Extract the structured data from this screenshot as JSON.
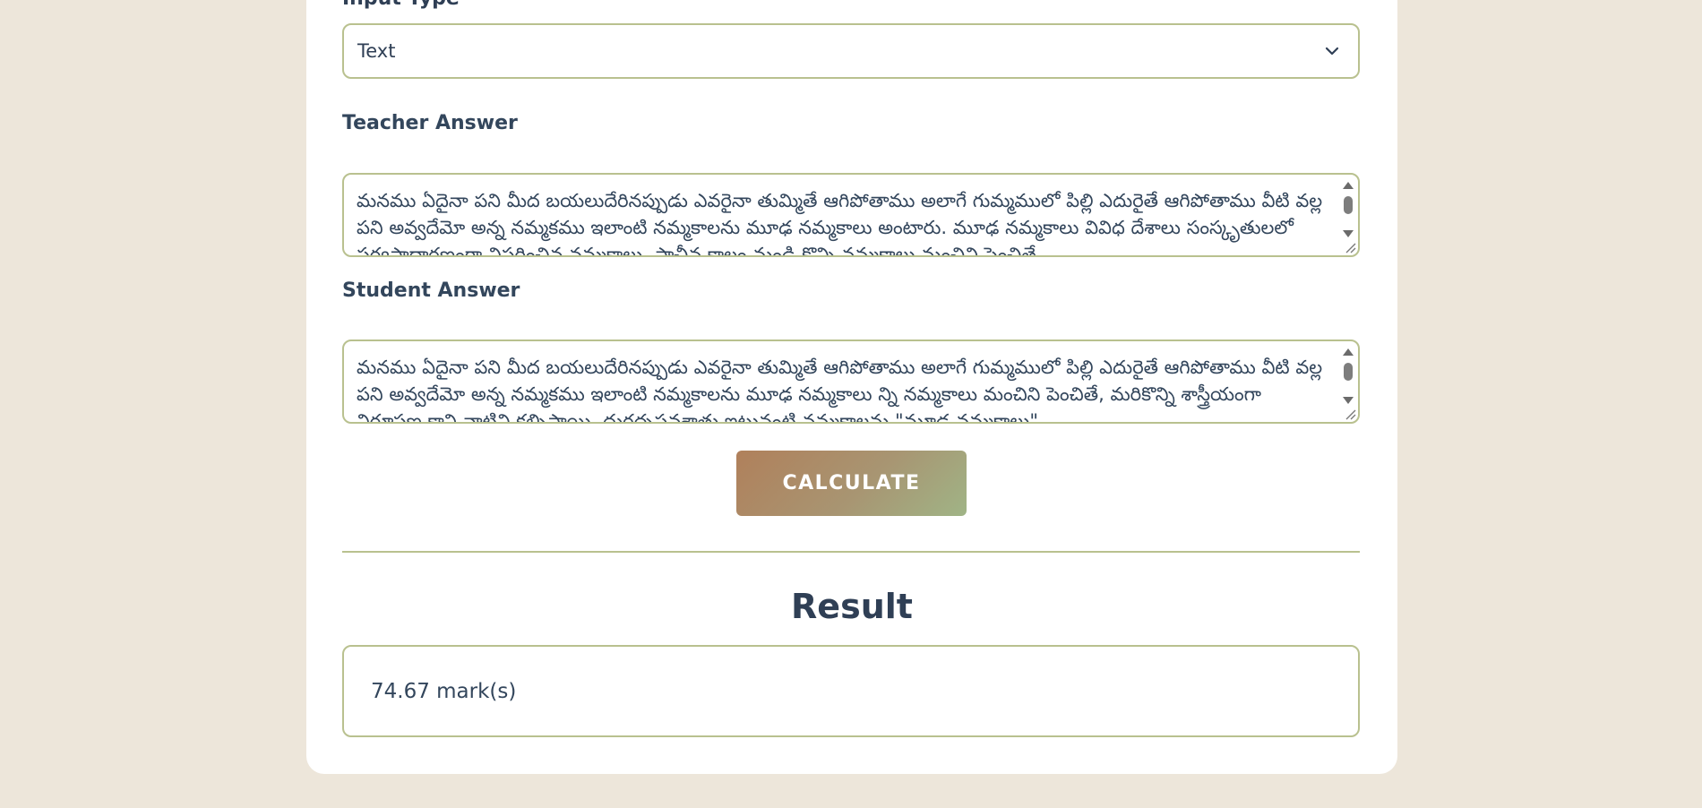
{
  "form": {
    "input_type_label": "Input Type",
    "input_type_value": "Text",
    "teacher_label": "Teacher Answer",
    "teacher_text": "మనము ఏదైనా పని మీద బయలుదేరినప్పుడు ఎవరైనా తుమ్మితే ఆగిపోతాము అలాగే గుమ్మములో పిల్లి ఎదురైతే ఆగిపోతాము వీటి వల్ల పని అవ్వదేమో అన్న నమ్మకము ఇలాంటి నమ్మకాలను మూఢ నమ్మకాలు అంటారు. మూఢ నమ్మకాలు వివిధ దేశాలు సంస్కృతులలో సర్వసాధారణంగా విస్తరించిన నమ్మకాలు. ప్రాచీన కాలం నుండి కొన్ని నమ్మకాలు మంచిని పెంచితే,",
    "student_label": "Student Answer",
    "student_text": "మనము ఏదైనా పని మీద బయలుదేరినప్పుడు ఎవరైనా తుమ్మితే ఆగిపోతాము అలాగే గుమ్మములో పిల్లి ఎదురైతే ఆగిపోతాము వీటి వల్ల పని అవ్వదేమో అన్న నమ్మకము ఇలాంటి నమ్మకాలను మూఢ నమ్మకాలు న్ని నమ్మకాలు మంచిని పెంచితే, మరికొన్ని శాస్త్రీయంగా నిరూపణ కాని వాటిని కల్పిస్తాయి. దురదృష్టవశాత్తు ఇటువంటి నమ్మకాలను \"మూఢ నమ్మకాలు\"",
    "calculate_label": "CALCULATE"
  },
  "result": {
    "heading": "Result",
    "value": "74.67 mark(s)"
  },
  "colors": {
    "background": "#ede6da",
    "card": "#ffffff",
    "border_accent": "#b9c18f",
    "text": "#2f3f55",
    "button_gradient_start": "#b0805b",
    "button_gradient_end": "#a0b486"
  },
  "icons": {
    "select_chevron": "chevron-down-icon",
    "resize": "resize-grip-icon"
  }
}
